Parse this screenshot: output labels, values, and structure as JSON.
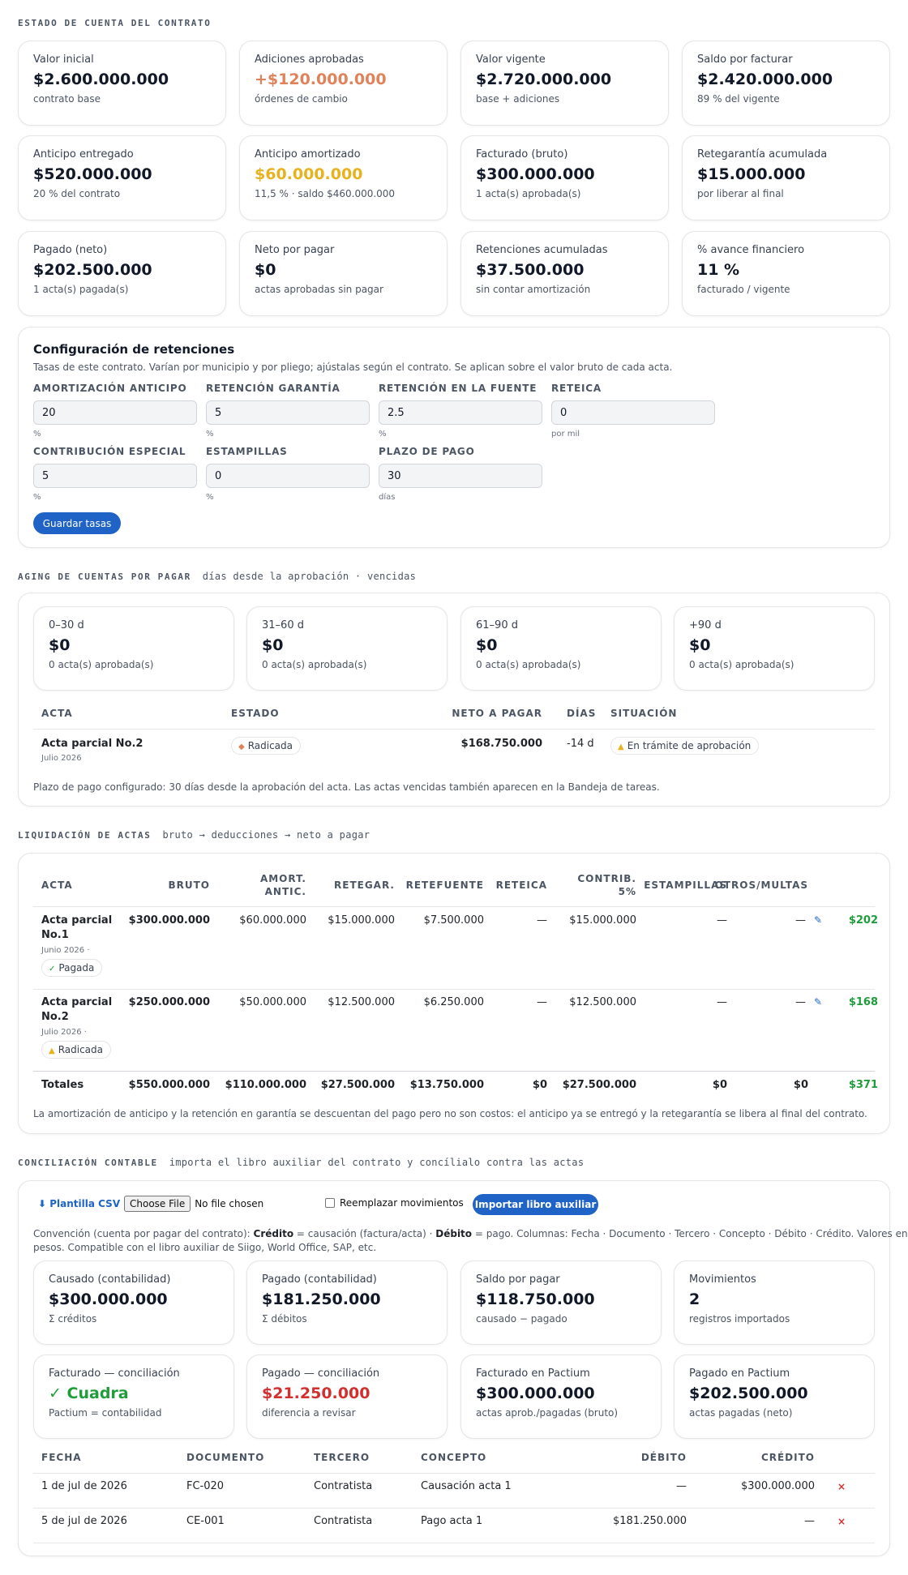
{
  "sections": {
    "estado": "Estado de cuenta del contrato",
    "aging": "Aging de cuentas por pagar",
    "aging_sub": "días desde la aprobación · vencidas",
    "liq": "Liquidación de actas",
    "liq_sub": "bruto → deducciones → neto a pagar",
    "conc": "Conciliación contable",
    "conc_sub": "importa el libro auxiliar del contrato y concílialo contra las actas"
  },
  "kpis": [
    {
      "label": "Valor inicial",
      "value": "$2.600.000.000",
      "sub": "contrato base",
      "color": "#111827"
    },
    {
      "label": "Adiciones aprobadas",
      "value": "+$120.000.000",
      "sub": "órdenes de cambio",
      "color": "#e0825a"
    },
    {
      "label": "Valor vigente",
      "value": "$2.720.000.000",
      "sub": "base + adiciones",
      "color": "#111827"
    },
    {
      "label": "Saldo por facturar",
      "value": "$2.420.000.000",
      "sub": "89 % del vigente",
      "color": "#111827"
    },
    {
      "label": "Anticipo entregado",
      "value": "$520.000.000",
      "sub": "20 % del contrato",
      "color": "#111827"
    },
    {
      "label": "Anticipo amortizado",
      "value": "$60.000.000",
      "sub": "11,5 % · saldo $460.000.000",
      "color": "#e8b21e"
    },
    {
      "label": "Facturado (bruto)",
      "value": "$300.000.000",
      "sub": "1 acta(s) aprobada(s)",
      "color": "#111827"
    },
    {
      "label": "Retegarantía acumulada",
      "value": "$15.000.000",
      "sub": "por liberar al final",
      "color": "#111827"
    },
    {
      "label": "Pagado (neto)",
      "value": "$202.500.000",
      "sub": "1 acta(s) pagada(s)",
      "color": "#111827"
    },
    {
      "label": "Neto por pagar",
      "value": "$0",
      "sub": "actas aprobadas sin pagar",
      "color": "#111827"
    },
    {
      "label": "Retenciones acumuladas",
      "value": "$37.500.000",
      "sub": "sin contar amortización",
      "color": "#111827"
    },
    {
      "label": "% avance financiero",
      "value": "11 %",
      "sub": "facturado / vigente",
      "color": "#111827"
    }
  ],
  "config": {
    "title": "Configuración de retenciones",
    "desc": "Tasas de este contrato. Varían por municipio y por pliego; ajústalas según el contrato. Se aplican sobre el valor bruto de cada acta.",
    "fields": [
      {
        "label": "Amortización anticipo",
        "value": "20",
        "unit": "%"
      },
      {
        "label": "Retención garantía",
        "value": "5",
        "unit": "%"
      },
      {
        "label": "Retención en la fuente",
        "value": "2.5",
        "unit": "%"
      },
      {
        "label": "ReteICA",
        "value": "0",
        "unit": "por mil"
      },
      {
        "label": "Contribución especial",
        "value": "5",
        "unit": "%"
      },
      {
        "label": "Estampillas",
        "value": "0",
        "unit": "%"
      },
      {
        "label": "Plazo de pago",
        "value": "30",
        "unit": "días"
      }
    ],
    "save": "Guardar tasas"
  },
  "aging": {
    "buckets": [
      {
        "label": "0–30 d",
        "value": "$0",
        "sub": "0 acta(s) aprobada(s)"
      },
      {
        "label": "31–60 d",
        "value": "$0",
        "sub": "0 acta(s) aprobada(s)"
      },
      {
        "label": "61–90 d",
        "value": "$0",
        "sub": "0 acta(s) aprobada(s)"
      },
      {
        "label": "+90 d",
        "value": "$0",
        "sub": "0 acta(s) aprobada(s)"
      }
    ],
    "headers": [
      "Acta",
      "Estado",
      "Neto a pagar",
      "Días",
      "Situación"
    ],
    "row": {
      "acta": "Acta parcial No.2",
      "date": "Julio 2026",
      "estado": "Radicada",
      "neto": "$168.750.000",
      "dias": "-14 d",
      "situacion": "En trámite de aprobación"
    },
    "note": "Plazo de pago configurado: 30 días desde la aprobación del acta. Las actas vencidas también aparecen en la Bandeja de tareas."
  },
  "liq": {
    "headers": [
      "Acta",
      "Bruto",
      "Amort.",
      "Antic.",
      "Retegar.",
      "Retefuente",
      "ReteICA",
      "Contrib.",
      "5%",
      "Estampillas",
      "Otros/Multas"
    ],
    "rows": [
      {
        "name1": "Acta parcial",
        "name2": "No.1",
        "date": "Junio 2026 ·",
        "status": "Pagada",
        "bruto": "$300.000.000",
        "amort": "$60.000.000",
        "retegar": "$15.000.000",
        "retefuente": "$7.500.000",
        "reteica": "—",
        "contrib": "$15.000.000",
        "estamp": "—",
        "otros": "—",
        "neto": "$202"
      },
      {
        "name1": "Acta parcial",
        "name2": "No.2",
        "date": "Julio 2026 ·",
        "status": "Radicada",
        "bruto": "$250.000.000",
        "amort": "$50.000.000",
        "retegar": "$12.500.000",
        "retefuente": "$6.250.000",
        "reteica": "—",
        "contrib": "$12.500.000",
        "estamp": "—",
        "otros": "—",
        "neto": "$168"
      }
    ],
    "totals": {
      "label": "Totales",
      "bruto": "$550.000.000",
      "amort": "$110.000.000",
      "retegar": "$27.500.000",
      "retefuente": "$13.750.000",
      "reteica": "$0",
      "contrib": "$27.500.000",
      "estamp": "$0",
      "otros": "$0",
      "neto": "$371"
    },
    "note": "La amortización de anticipo y la retención en garantía se descuentan del pago pero no son costos: el anticipo ya se entregó y la retegarantía se libera al final del contrato."
  },
  "conc": {
    "plantilla": "Plantilla CSV",
    "choose": "Choose File",
    "nofile": "No file chosen",
    "reemplazar": "Reemplazar movimientos",
    "importar": "Importar libro auxiliar",
    "conv1_a": "Convención (cuenta por pagar del contrato): ",
    "conv1_b": "Crédito",
    "conv1_c": " = causación (factura/acta) · ",
    "conv1_d": "Débito",
    "conv1_e": " = pago. Columnas: Fecha · Documento · Tercero · Concepto · Débito · Crédito. Valores en",
    "conv2": "pesos. Compatible con el libro auxiliar de Siigo, World Office, SAP, etc.",
    "kpis": [
      {
        "label": "Causado (contabilidad)",
        "value": "$300.000.000",
        "sub": "Σ créditos",
        "color": "#111827"
      },
      {
        "label": "Pagado (contabilidad)",
        "value": "$181.250.000",
        "sub": "Σ débitos",
        "color": "#111827"
      },
      {
        "label": "Saldo por pagar",
        "value": "$118.750.000",
        "sub": "causado − pagado",
        "color": "#111827"
      },
      {
        "label": "Movimientos",
        "value": "2",
        "sub": "registros importados",
        "color": "#111827"
      },
      {
        "label": "Facturado — conciliación",
        "value": "✓ Cuadra",
        "sub": "Pactium = contabilidad",
        "color": "#1f9d3a"
      },
      {
        "label": "Pagado — conciliación",
        "value": "$21.250.000",
        "sub": "diferencia a revisar",
        "color": "#d32f2f"
      },
      {
        "label": "Facturado en Pactium",
        "value": "$300.000.000",
        "sub": "actas aprob./pagadas (bruto)",
        "color": "#111827"
      },
      {
        "label": "Pagado en Pactium",
        "value": "$202.500.000",
        "sub": "actas pagadas (neto)",
        "color": "#111827"
      }
    ],
    "headers": [
      "Fecha",
      "Documento",
      "Tercero",
      "Concepto",
      "Débito",
      "Crédito"
    ],
    "rows": [
      {
        "fecha": "1 de jul de 2026",
        "doc": "FC-020",
        "tercero": "Contratista",
        "concepto": "Causación acta 1",
        "debito": "—",
        "credito": "$300.000.000"
      },
      {
        "fecha": "5 de jul de 2026",
        "doc": "CE-001",
        "tercero": "Contratista",
        "concepto": "Pago acta 1",
        "debito": "$181.250.000",
        "credito": "—"
      }
    ]
  }
}
